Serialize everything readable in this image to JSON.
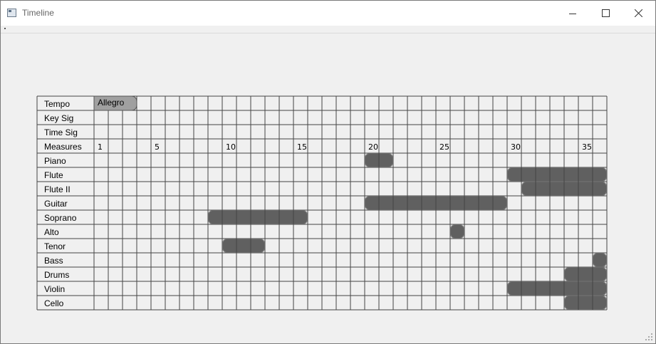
{
  "window": {
    "title": "Timeline",
    "buttons": {
      "minimize": "minimize-icon",
      "maximize": "maximize-icon",
      "close": "close-icon"
    }
  },
  "timeline": {
    "measure_count": 36,
    "rows": [
      {
        "label": "Tempo",
        "kind": "marker",
        "marker": {
          "text": "Allegro",
          "start": 1,
          "end": 3
        }
      },
      {
        "label": "Key Sig",
        "kind": "empty"
      },
      {
        "label": "Time Sig",
        "kind": "empty"
      },
      {
        "label": "Measures",
        "kind": "ruler",
        "numbers": [
          1,
          5,
          10,
          15,
          20,
          25,
          30,
          35
        ]
      },
      {
        "label": "Piano",
        "kind": "track",
        "blocks": [
          [
            20,
            21
          ]
        ]
      },
      {
        "label": "Flute",
        "kind": "track",
        "blocks": [
          [
            30,
            36
          ]
        ]
      },
      {
        "label": "Flute II",
        "kind": "track",
        "blocks": [
          [
            31,
            36
          ]
        ]
      },
      {
        "label": "Guitar",
        "kind": "track",
        "blocks": [
          [
            20,
            29
          ]
        ]
      },
      {
        "label": "Soprano",
        "kind": "track",
        "blocks": [
          [
            9,
            15
          ]
        ]
      },
      {
        "label": "Alto",
        "kind": "track",
        "blocks": [
          [
            26,
            26
          ]
        ]
      },
      {
        "label": "Tenor",
        "kind": "track",
        "blocks": [
          [
            10,
            12
          ]
        ]
      },
      {
        "label": "Bass",
        "kind": "track",
        "blocks": [
          [
            36,
            36
          ]
        ]
      },
      {
        "label": "Drums",
        "kind": "track",
        "blocks": [
          [
            34,
            36
          ]
        ]
      },
      {
        "label": "Violin",
        "kind": "track",
        "blocks": [
          [
            30,
            36
          ]
        ]
      },
      {
        "label": "Cello",
        "kind": "track",
        "blocks": [
          [
            34,
            36
          ]
        ]
      }
    ]
  },
  "colors": {
    "block_fill": "#606060",
    "marker_fill": "#a0a0a0",
    "grid_line": "#454545",
    "background": "#f0f0f0"
  }
}
